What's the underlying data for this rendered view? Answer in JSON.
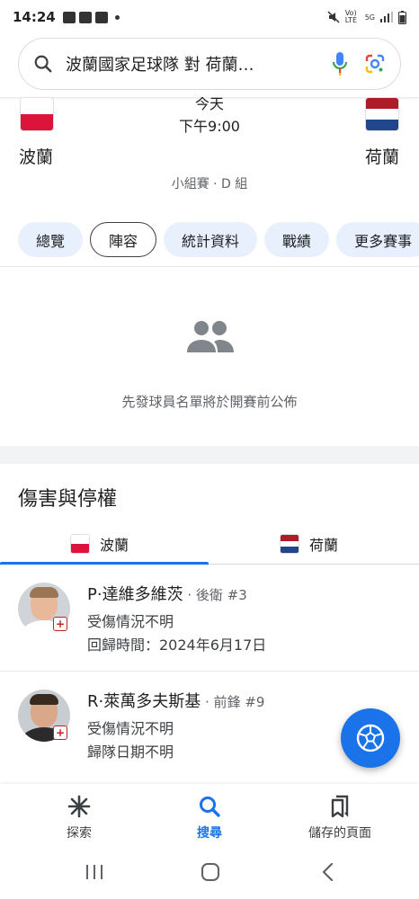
{
  "status_bar": {
    "time": "14:24",
    "network": "Vo) LTE",
    "gen": "5G"
  },
  "search": {
    "query": "波蘭國家足球隊 對 荷蘭…"
  },
  "match": {
    "day": "今天",
    "time": "下午9:00",
    "home_team": "波蘭",
    "away_team": "荷蘭",
    "stage": "小組賽 · D 組"
  },
  "tabs": [
    "總覽",
    "陣容",
    "統計資料",
    "戰績",
    "更多賽事"
  ],
  "active_tab": "陣容",
  "lineup": {
    "message": "先發球員名單將於開賽前公佈"
  },
  "injuries": {
    "title": "傷害與停權",
    "team_tabs": [
      "波蘭",
      "荷蘭"
    ],
    "players": [
      {
        "name": "P·達維多維茨",
        "position": " · 後衛 #3",
        "status": "受傷情況不明",
        "return": "回歸時間：2024年6月17日"
      },
      {
        "name": "R·萊萬多夫斯基",
        "position": " · 前鋒 #9",
        "status": "受傷情況不明",
        "return": "歸隊日期不明"
      }
    ]
  },
  "bottom_nav": {
    "explore": "探索",
    "search": "搜尋",
    "saved": "儲存的頁面"
  },
  "colors": {
    "accent": "#1a73e8",
    "chip_bg": "#e8f0fe",
    "injury": "#c5221f"
  }
}
